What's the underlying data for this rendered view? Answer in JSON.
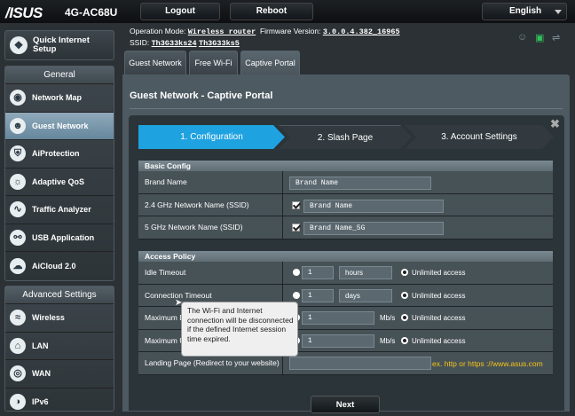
{
  "topbar": {
    "logo": "/ISUS",
    "model": "4G-AC68U",
    "logout_label": "Logout",
    "reboot_label": "Reboot",
    "language": "English"
  },
  "status": {
    "opmode_label": "Operation Mode:",
    "opmode_value": "Wireless router",
    "fw_label": "Firmware Version:",
    "fw_value": "3.0.0.4.382_16965",
    "ssid_label": "SSID:",
    "ssid1": "Th3G33ks24",
    "ssid2": "Th3G33ks5"
  },
  "sidebar": {
    "qis_label": "Quick Internet Setup",
    "general_header": "General",
    "general_items": [
      {
        "label": "Network Map",
        "icon": "network-map-icon"
      },
      {
        "label": "Guest Network",
        "icon": "guest-network-icon",
        "active": true
      },
      {
        "label": "AiProtection",
        "icon": "aiprotection-icon"
      },
      {
        "label": "Adaptive QoS",
        "icon": "qos-icon"
      },
      {
        "label": "Traffic Analyzer",
        "icon": "traffic-analyzer-icon"
      },
      {
        "label": "USB Application",
        "icon": "usb-icon"
      },
      {
        "label": "AiCloud 2.0",
        "icon": "cloud-icon"
      }
    ],
    "advanced_header": "Advanced Settings",
    "advanced_items": [
      {
        "label": "Wireless",
        "icon": "wireless-icon"
      },
      {
        "label": "LAN",
        "icon": "lan-icon"
      },
      {
        "label": "WAN",
        "icon": "wan-icon"
      },
      {
        "label": "IPv6",
        "icon": "ipv6-icon"
      }
    ]
  },
  "tabs": [
    "Guest Network",
    "Free Wi-Fi",
    "Captive Portal"
  ],
  "page_title": "Guest Network - Captive Portal",
  "steps": [
    "1. Configuration",
    "2. Slash Page",
    "3. Account Settings"
  ],
  "basic": {
    "header": "Basic Config",
    "brand_label": "Brand Name",
    "brand_value": "Brand Name",
    "ssid24_label": "2.4 GHz Network Name (SSID)",
    "ssid24_value": "Brand Name",
    "ssid5_label": "5 GHz Network Name (SSID)",
    "ssid5_value": "Brand Name_5G"
  },
  "access": {
    "header": "Access Policy",
    "idle_label": "Idle Timeout",
    "idle_value": "1",
    "idle_unit": "hours",
    "conn_label": "Connection Timeout",
    "conn_value": "1",
    "conn_unit": "days",
    "maxd_label": "Maximum D",
    "maxd_value": "1",
    "maxu_label": "Maximum U",
    "maxu_value": "1",
    "rate_unit": "Mb/s",
    "unlimited": "Unlimited access",
    "landing_label": "Landing Page (Redirect to your website)",
    "landing_hint": "ex. http or https ://www.asus.com"
  },
  "tooltip": "The Wi-Fi and Internet connection will be disconnected if the defined Internet session time expired.",
  "next_label": "Next",
  "colors": {
    "step_active": "#1fa2e0",
    "hint": "#f5c518"
  }
}
